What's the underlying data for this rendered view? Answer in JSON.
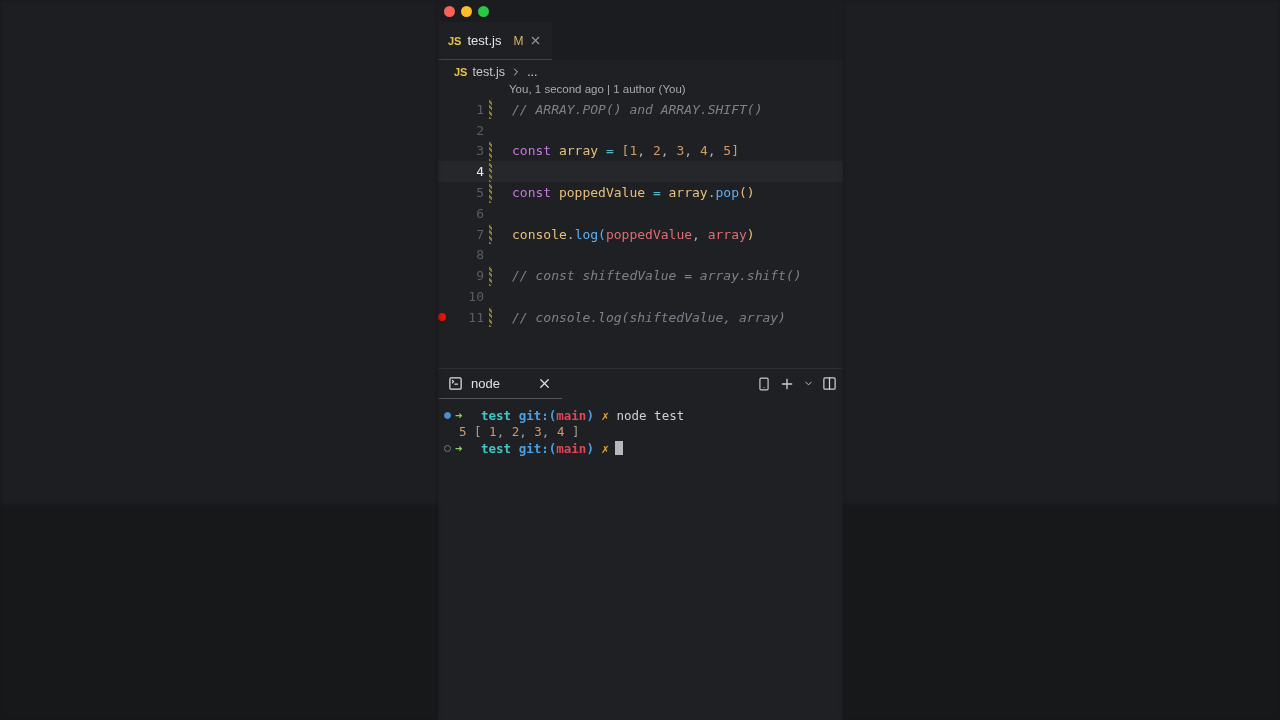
{
  "editor": {
    "tabs": [
      {
        "icon": "JS",
        "label": "test.js",
        "badge": "M",
        "selected": true
      }
    ],
    "breadcrumb": {
      "icon": "JS",
      "file": "test.js",
      "rest": "..."
    },
    "codelens": "You, 1 second ago | 1 author (You)",
    "lines": [
      {
        "number": "1",
        "current": false,
        "breakpoint": false,
        "modified": true,
        "tokens": [
          {
            "text": "// ARRAY.POP() and ARRAY.SHIFT()",
            "kind": "comment"
          }
        ]
      },
      {
        "number": "2",
        "current": false,
        "breakpoint": false,
        "modified": false
      },
      {
        "number": "3",
        "current": false,
        "breakpoint": false,
        "modified": true,
        "tokens": [
          {
            "text": "const",
            "kind": "keyword"
          },
          {
            "text": " array ",
            "kind": "variable"
          },
          {
            "text": "=",
            "kind": "operator"
          },
          {
            "text": " [",
            "kind": "number"
          },
          {
            "text": "1",
            "kind": "number"
          },
          {
            "text": ", ",
            "kind": "punct"
          },
          {
            "text": "2",
            "kind": "number"
          },
          {
            "text": ", ",
            "kind": "punct"
          },
          {
            "text": "3",
            "kind": "number"
          },
          {
            "text": ", ",
            "kind": "punct"
          },
          {
            "text": "4",
            "kind": "number"
          },
          {
            "text": ", ",
            "kind": "punct"
          },
          {
            "text": "5]",
            "kind": "number"
          }
        ]
      },
      {
        "number": "4",
        "current": true,
        "breakpoint": false,
        "modified": true
      },
      {
        "number": "5",
        "current": false,
        "breakpoint": false,
        "modified": true,
        "tokens": [
          {
            "text": "const",
            "kind": "keyword"
          },
          {
            "text": " poppedValue ",
            "kind": "variable"
          },
          {
            "text": "=",
            "kind": "operator"
          },
          {
            "text": " array",
            "kind": "variable"
          },
          {
            "text": ".",
            "kind": "punct"
          },
          {
            "text": "pop",
            "kind": "function"
          },
          {
            "text": "()",
            "kind": "variable"
          }
        ]
      },
      {
        "number": "6",
        "current": false,
        "breakpoint": false,
        "modified": false
      },
      {
        "number": "7",
        "current": false,
        "breakpoint": false,
        "modified": true,
        "tokens": [
          {
            "text": "console",
            "kind": "variable"
          },
          {
            "text": ".",
            "kind": "punct"
          },
          {
            "text": "log",
            "kind": "function"
          },
          {
            "text": "(",
            "kind": "function"
          },
          {
            "text": "poppedValue",
            "kind": "param"
          },
          {
            "text": ", ",
            "kind": "punct"
          },
          {
            "text": "array",
            "kind": "param"
          },
          {
            "text": ")",
            "kind": "variable"
          }
        ]
      },
      {
        "number": "8",
        "current": false,
        "breakpoint": false,
        "modified": false
      },
      {
        "number": "9",
        "current": false,
        "breakpoint": false,
        "modified": true,
        "tokens": [
          {
            "text": "// const shiftedValue = array.shift()",
            "kind": "comment"
          }
        ]
      },
      {
        "number": "10",
        "current": false,
        "breakpoint": false,
        "modified": false
      },
      {
        "number": "11",
        "current": false,
        "breakpoint": true,
        "modified": true,
        "tokens": [
          {
            "text": "// console.log(shiftedValue, array)",
            "kind": "comment"
          }
        ]
      }
    ]
  },
  "terminal": {
    "tabs": [
      {
        "label": "node",
        "selected": true
      }
    ],
    "lines": [
      {
        "kind": "prompt",
        "finished": true,
        "arrow": "➜",
        "tokens": [
          {
            "text": "test",
            "kind": "dir"
          },
          {
            "text": " git:(",
            "kind": "git"
          },
          {
            "text": "main",
            "kind": "branch"
          },
          {
            "text": ")",
            "kind": "git"
          },
          {
            "text": " ✗",
            "kind": "dirty"
          },
          {
            "text": " node test",
            "kind": "command"
          }
        ]
      },
      {
        "kind": "output",
        "tokens": [
          {
            "text": "5",
            "kind": "number"
          },
          {
            "text": " [ ",
            "kind": "punct"
          },
          {
            "text": "1",
            "kind": "number"
          },
          {
            "text": ", ",
            "kind": "punct"
          },
          {
            "text": "2",
            "kind": "number"
          },
          {
            "text": ", ",
            "kind": "punct"
          },
          {
            "text": "3",
            "kind": "number"
          },
          {
            "text": ", ",
            "kind": "punct"
          },
          {
            "text": "4",
            "kind": "number"
          },
          {
            "text": " ]",
            "kind": "punct"
          }
        ]
      },
      {
        "kind": "prompt",
        "finished": false,
        "arrow": "➜",
        "cursor": true,
        "tokens": [
          {
            "text": "test",
            "kind": "dir"
          },
          {
            "text": " git:(",
            "kind": "git"
          },
          {
            "text": "main",
            "kind": "branch"
          },
          {
            "text": ")",
            "kind": "git"
          },
          {
            "text": " ✗",
            "kind": "dirty"
          }
        ]
      }
    ]
  }
}
